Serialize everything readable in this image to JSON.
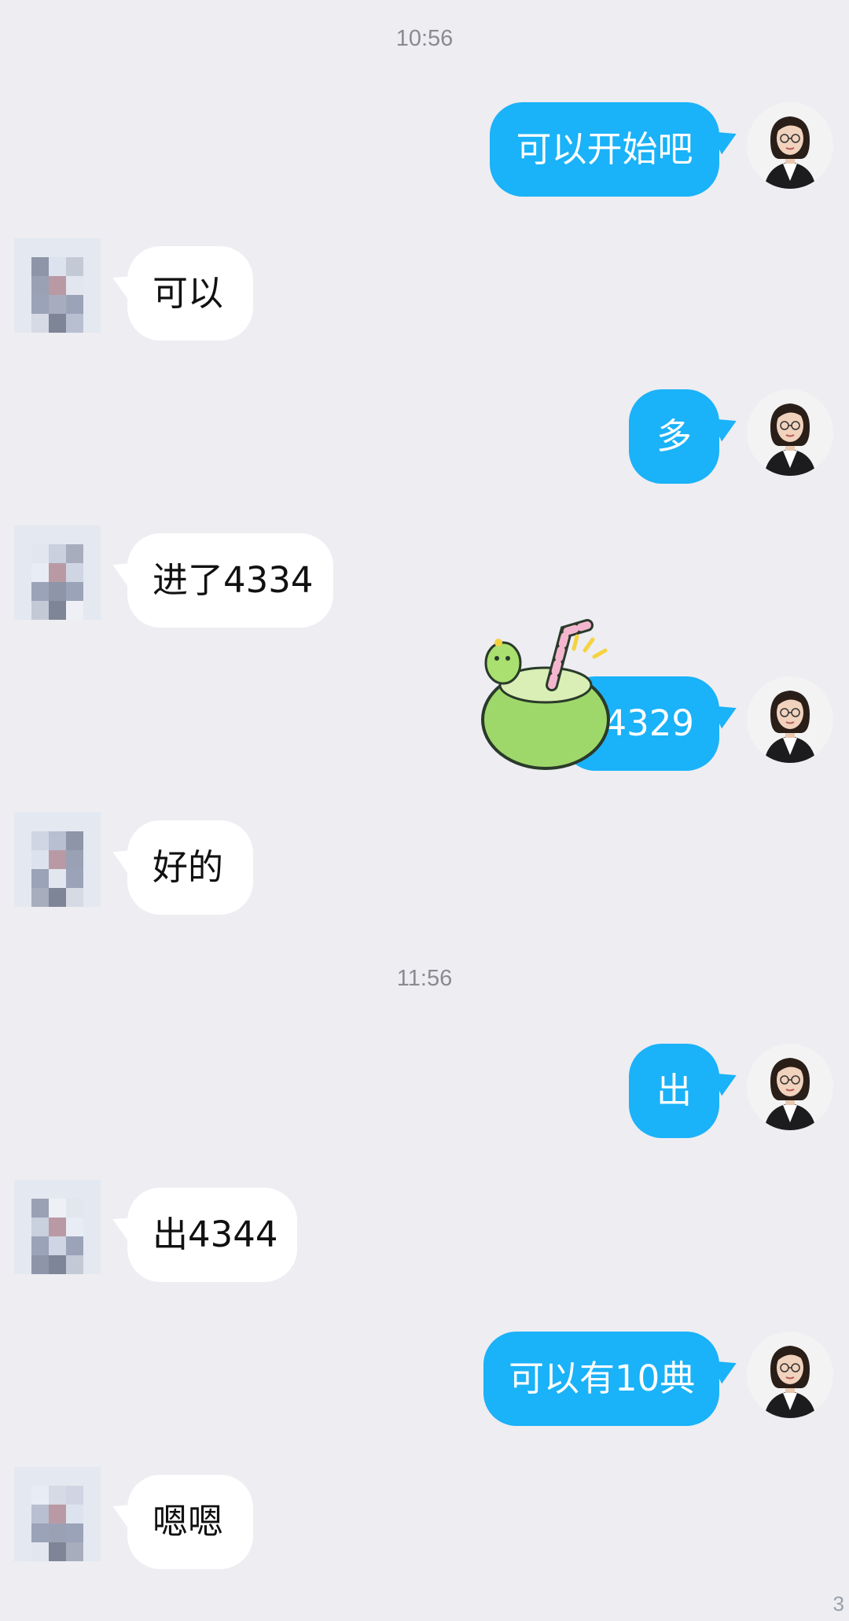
{
  "timestamps": [
    "10:56",
    "11:56"
  ],
  "messages": [
    {
      "from": "me",
      "text": "可以开始吧"
    },
    {
      "from": "them",
      "text": "可以"
    },
    {
      "from": "me",
      "text": "多"
    },
    {
      "from": "them",
      "text": "进了4334"
    },
    {
      "from": "me",
      "text": "j4329"
    },
    {
      "from": "them",
      "text": "好的"
    },
    {
      "from": "me",
      "text": "出"
    },
    {
      "from": "them",
      "text": "出4344"
    },
    {
      "from": "me",
      "text": "可以有10典"
    },
    {
      "from": "them",
      "text": "嗯嗯"
    }
  ],
  "colors": {
    "my_bubble": "#1ab2f8",
    "their_bubble": "#ffffff",
    "background": "#ededf2"
  },
  "icons": [
    "avatar-woman-photo",
    "avatar-blurred",
    "coconut-sticker"
  ],
  "corner_text": "3"
}
